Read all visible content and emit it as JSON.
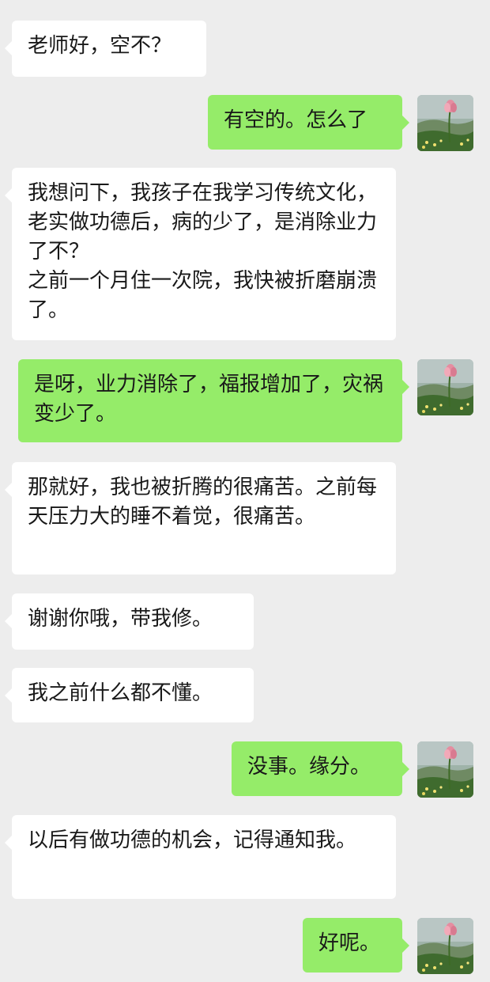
{
  "messages": [
    {
      "side": "left",
      "text": "老师好，空不？"
    },
    {
      "side": "right",
      "text": "有空的。怎么了"
    },
    {
      "side": "left",
      "text": "我想问下，我孩子在我学习传统文化，老实做功德后，病的少了，是消除业力了不？\n之前一个月住一次院，我快被折磨崩溃了。"
    },
    {
      "side": "right",
      "text": "是呀，业力消除了，福报增加了，灾祸变少了。"
    },
    {
      "side": "left",
      "text": "那就好，我也被折腾的很痛苦。之前每天压力大的睡不着觉，很痛苦。"
    },
    {
      "side": "left",
      "text": "谢谢你哦，带我修。"
    },
    {
      "side": "left",
      "text": "我之前什么都不懂。"
    },
    {
      "side": "right",
      "text": "没事。缘分。"
    },
    {
      "side": "left",
      "text": "以后有做功德的机会，记得通知我。"
    },
    {
      "side": "right",
      "text": "好呢。"
    }
  ],
  "avatar": {
    "icon": "lotus-avatar-icon"
  },
  "colors": {
    "background": "#ededed",
    "incoming_bubble": "#ffffff",
    "outgoing_bubble": "#95ec69",
    "text": "#191919"
  }
}
